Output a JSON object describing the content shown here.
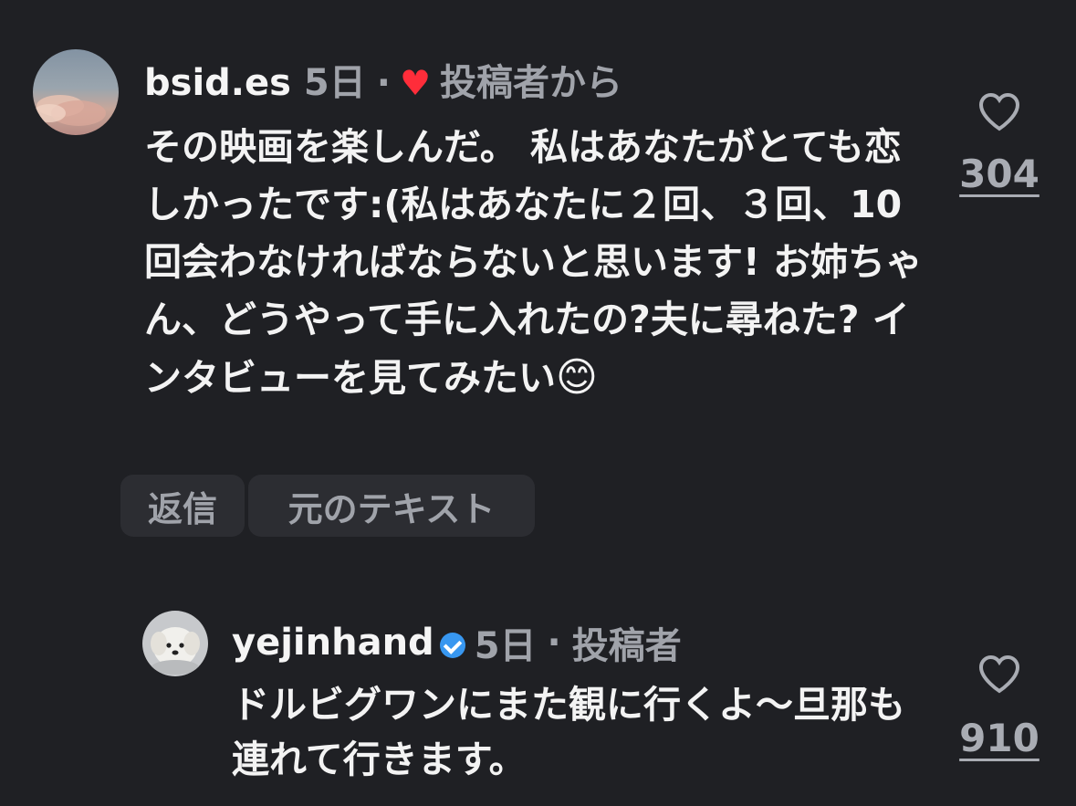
{
  "comment1": {
    "username": "bsid.es",
    "age": "5日",
    "separator": "·",
    "heart_glyph": "♥",
    "author_liked_label": "投稿者から",
    "text": "その映画を楽しんだ。 私はあなたがとても恋しかったです:(私はあなたに２回、３回、10回会わなければならないと思います! お姉ちゃん、どうやって手に入れたの?夫に尋ねた? インタビューを見てみたい",
    "emoji": "😊",
    "like_count": "304",
    "reply_label": "返信",
    "original_text_label": "元のテキスト"
  },
  "reply1": {
    "username": "yejinhand",
    "age": "5日",
    "separator": "·",
    "author_label": "投稿者",
    "text": "ドルビグワンにまた観に行くよ〜旦那も連れて行きます。",
    "like_count": "910"
  },
  "colors": {
    "background": "#1f2024",
    "meta": "#a0a3aa",
    "heart_red": "#ff2d3a",
    "verified_blue": "#3897f0"
  },
  "icons": {
    "like": "heart-outline-icon",
    "verified": "verified-badge-icon"
  }
}
